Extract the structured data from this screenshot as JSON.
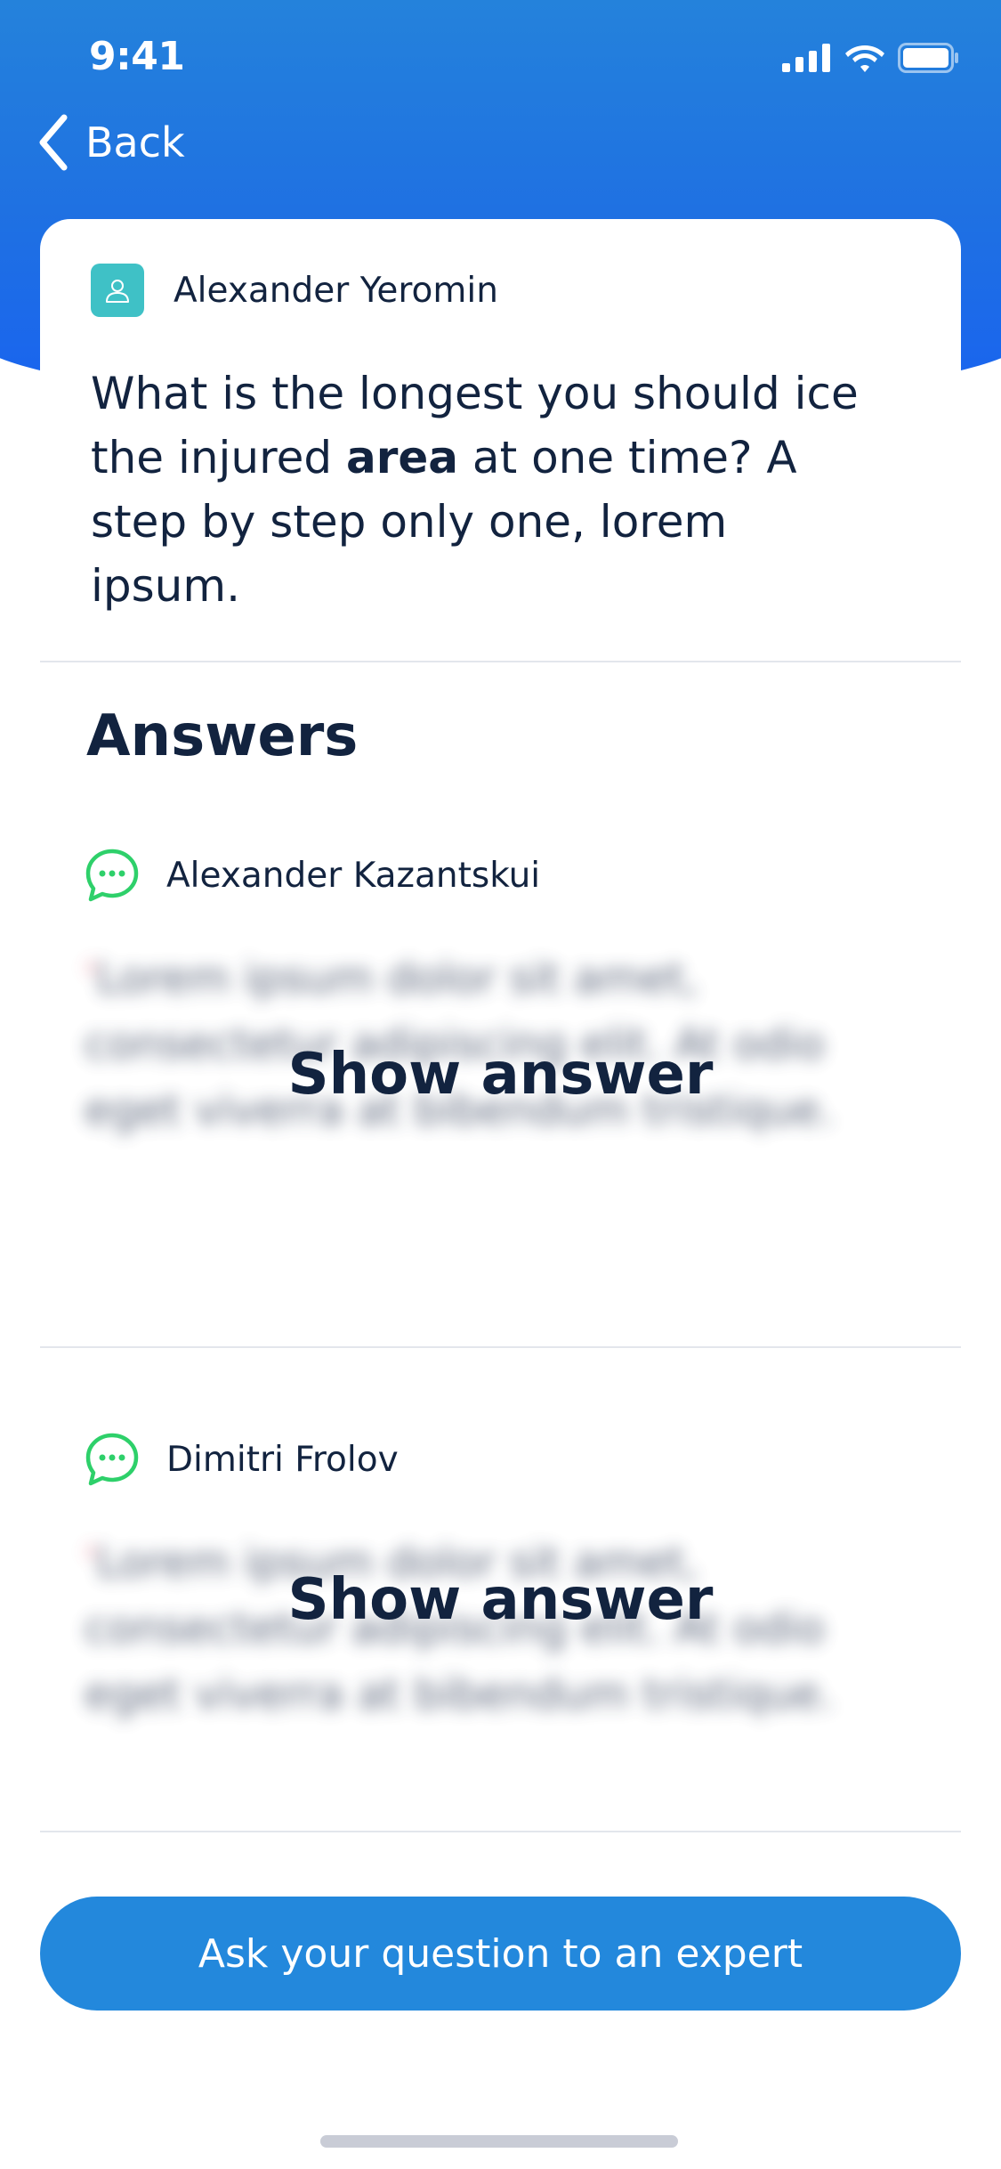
{
  "status_bar": {
    "time": "9:41",
    "icons": [
      "signal-icon",
      "wifi-icon",
      "battery-icon"
    ]
  },
  "nav": {
    "back_label": "Back",
    "back_icon": "chevron-left-icon"
  },
  "question": {
    "author": "Alexander Yeromin",
    "author_icon": "user-icon",
    "text_before": "What is the longest you should ice the injured ",
    "text_bold": "area",
    "text_after": " at one time? A step by step only one, lorem ipsum."
  },
  "answers": {
    "title": "Answers",
    "items": [
      {
        "author": "Alexander Kazantskui",
        "icon": "chat-bubble-icon",
        "blurred_text": "Lorem ipsum dolor sit amet, consectetur adipiscing elit. At odio eget viverra at bibendum tristique.",
        "show_label": "Show answer"
      },
      {
        "author": "Dimitri Frolov",
        "icon": "chat-bubble-icon",
        "blurred_text": "Lorem ipsum dolor sit amet, consectetur adipiscing elit. At odio eget viverra at bibendum tristique.",
        "show_label": "Show answer"
      }
    ]
  },
  "cta": {
    "label": "Ask your question to an expert"
  },
  "colors": {
    "header_gradient_top": "#2585da",
    "header_gradient_bottom": "#1963f0",
    "primary_button": "#2388dc",
    "avatar_bg": "#3fc1c6",
    "chat_icon": "#2ed06a",
    "text_dark": "#12233f"
  }
}
